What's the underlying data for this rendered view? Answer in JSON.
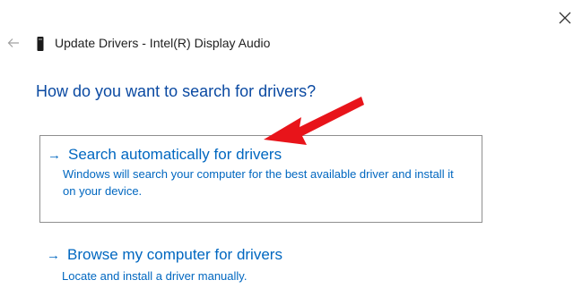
{
  "window": {
    "title": "Update Drivers - Intel(R) Display Audio",
    "back_icon": "back-arrow-icon",
    "close_icon": "close-icon",
    "device_icon": "device-icon"
  },
  "main": {
    "heading": "How do you want to search for drivers?",
    "options": [
      {
        "title": "Search automatically for drivers",
        "description": "Windows will search your computer for the best available driver and install it on your device."
      },
      {
        "title": "Browse my computer for drivers",
        "description": "Locate and install a driver manually."
      }
    ]
  },
  "annotation": {
    "arrow_color": "#e8141a",
    "arrow_icon": "red-pointer-arrow"
  },
  "colors": {
    "link": "#0067c0",
    "heading": "#0b4aa2",
    "box_border": "#8f8f8f"
  }
}
